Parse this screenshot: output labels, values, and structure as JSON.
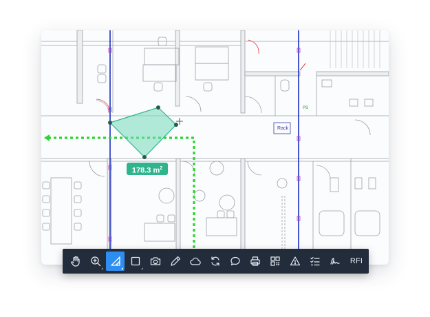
{
  "measurement": {
    "value": "178.3 m",
    "unit_sup": "2"
  },
  "plan_labels": {
    "rack": "Rack",
    "ps": "PS"
  },
  "toolbar": {
    "tools": [
      {
        "id": "pan",
        "icon": "hand-icon",
        "active": false,
        "has_submenu": false
      },
      {
        "id": "zoom",
        "icon": "zoom-in-icon",
        "active": false,
        "has_submenu": true
      },
      {
        "id": "measure-area",
        "icon": "ruler-triangle-icon",
        "active": true,
        "has_submenu": true
      },
      {
        "id": "rectangle",
        "icon": "square-icon",
        "active": false,
        "has_submenu": true
      },
      {
        "id": "photo",
        "icon": "camera-icon",
        "active": false,
        "has_submenu": false
      },
      {
        "id": "pencil",
        "icon": "pencil-icon",
        "active": false,
        "has_submenu": false
      },
      {
        "id": "cloud",
        "icon": "cloud-icon",
        "active": false,
        "has_submenu": false
      },
      {
        "id": "sync",
        "icon": "refresh-icon",
        "active": false,
        "has_submenu": false
      },
      {
        "id": "comment",
        "icon": "speech-bubble-icon",
        "active": false,
        "has_submenu": false
      },
      {
        "id": "print",
        "icon": "printer-icon",
        "active": false,
        "has_submenu": false
      },
      {
        "id": "qr",
        "icon": "qr-code-icon",
        "active": false,
        "has_submenu": false
      },
      {
        "id": "issue",
        "icon": "warning-triangle-icon",
        "active": false,
        "has_submenu": false
      },
      {
        "id": "checklist",
        "icon": "checklist-icon",
        "active": false,
        "has_submenu": false
      },
      {
        "id": "signature",
        "icon": "signature-icon",
        "active": false,
        "has_submenu": false
      }
    ],
    "rfi_label": "RFI"
  },
  "colors": {
    "toolbar_bg": "#232c3b",
    "active_tool": "#2e8df0",
    "measure_fill": "#2fb48c",
    "grid_line_blue": "#1a2ec2",
    "green_path": "#2bd431",
    "magenta_marker": "#cc33cc"
  }
}
